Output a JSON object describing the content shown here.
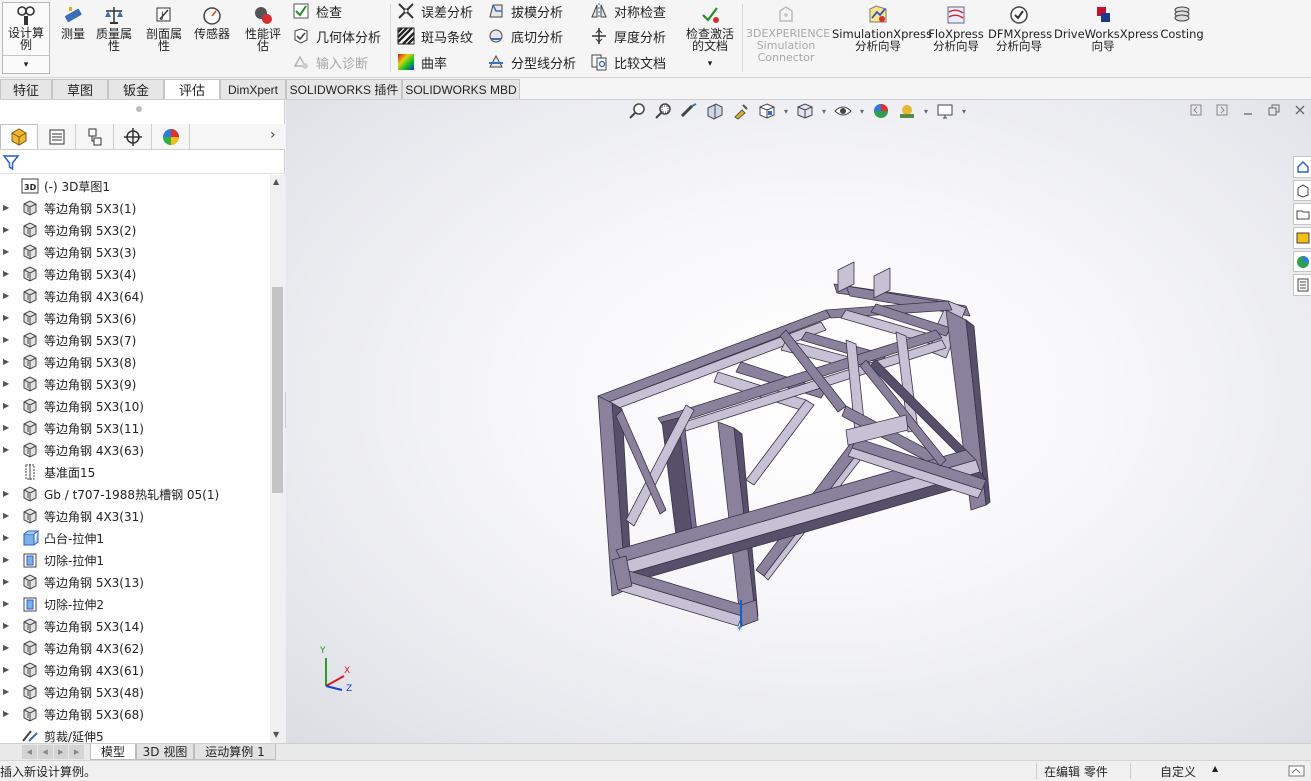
{
  "ribbon": {
    "design_study": "设计算例",
    "measure": "测量",
    "mass_props": "质量属性",
    "section_props": "剖面属性",
    "sensor": "传感器",
    "perf_eval": "性能评估",
    "check": "检查",
    "geometry_analysis": "几何体分析",
    "import_diagnostics": "输入诊断",
    "deviation_analysis": "误差分析",
    "zebra_stripes": "斑马条纹",
    "curvature": "曲率",
    "draft_analysis": "拔模分析",
    "undercut_analysis": "底切分析",
    "parting_line_analysis": "分型线分析",
    "symmetry_check": "对称检查",
    "thickness_analysis": "厚度分析",
    "compare_documents": "比较文档",
    "check_active_doc": "检查激活的文档",
    "experience_sim": "3DEXPERIENCE Simulation Connector",
    "simxpress": "SimulationXpress 分析向导",
    "floxpress": "FloXpress 分析向导",
    "dfmxpress": "DFMXpress 分析向导",
    "driveworks": "DriveWorksXpress 向导",
    "costing": "Costing"
  },
  "tabs": [
    "特征",
    "草图",
    "钣金",
    "评估",
    "DimXpert",
    "SOLIDWORKS 插件",
    "SOLIDWORKS MBD"
  ],
  "active_tab": "评估",
  "tree": [
    {
      "label": "(-) 3D草图1",
      "icon": "sketch3d",
      "exp": false
    },
    {
      "label": "等边角钢 5X3(1)",
      "icon": "part",
      "exp": true
    },
    {
      "label": "等边角钢 5X3(2)",
      "icon": "part",
      "exp": true
    },
    {
      "label": "等边角钢 5X3(3)",
      "icon": "part",
      "exp": true
    },
    {
      "label": "等边角钢 5X3(4)",
      "icon": "part",
      "exp": true
    },
    {
      "label": "等边角钢 4X3(64)",
      "icon": "part",
      "exp": true
    },
    {
      "label": "等边角钢 5X3(6)",
      "icon": "part",
      "exp": true
    },
    {
      "label": "等边角钢 5X3(7)",
      "icon": "part",
      "exp": true
    },
    {
      "label": "等边角钢 5X3(8)",
      "icon": "part",
      "exp": true
    },
    {
      "label": "等边角钢 5X3(9)",
      "icon": "part",
      "exp": true
    },
    {
      "label": "等边角钢 5X3(10)",
      "icon": "part",
      "exp": true
    },
    {
      "label": "等边角钢 5X3(11)",
      "icon": "part",
      "exp": true
    },
    {
      "label": "等边角钢 4X3(63)",
      "icon": "part",
      "exp": true
    },
    {
      "label": "基准面15",
      "icon": "plane",
      "exp": false
    },
    {
      "label": "Gb / t707-1988热轧槽钢 05(1)",
      "icon": "part",
      "exp": true
    },
    {
      "label": "等边角钢 4X3(31)",
      "icon": "part",
      "exp": true
    },
    {
      "label": "凸台-拉伸1",
      "icon": "boss",
      "exp": true
    },
    {
      "label": "切除-拉伸1",
      "icon": "cut",
      "exp": true
    },
    {
      "label": "等边角钢 5X3(13)",
      "icon": "part",
      "exp": true
    },
    {
      "label": "切除-拉伸2",
      "icon": "cut",
      "exp": true
    },
    {
      "label": "等边角钢 5X3(14)",
      "icon": "part",
      "exp": true
    },
    {
      "label": "等边角钢 4X3(62)",
      "icon": "part",
      "exp": true
    },
    {
      "label": "等边角钢 4X3(61)",
      "icon": "part",
      "exp": true
    },
    {
      "label": "等边角钢 5X3(48)",
      "icon": "part",
      "exp": true
    },
    {
      "label": "等边角钢 5X3(68)",
      "icon": "part",
      "exp": true
    },
    {
      "label": "剪裁/延伸5",
      "icon": "trim",
      "exp": false
    }
  ],
  "bottom_tabs": [
    "模型",
    "3D 视图",
    "运动算例 1"
  ],
  "status": {
    "message": "插入新设计算例。",
    "editing": "在编辑 零件",
    "custom": "自定义"
  },
  "triad": {
    "y": "Y",
    "x": "X",
    "z": "Z"
  },
  "colors": {
    "frame": "#8a829c",
    "frame_dark": "#57506a",
    "frame_light": "#c6c1d4",
    "accent": "#1560c8"
  }
}
